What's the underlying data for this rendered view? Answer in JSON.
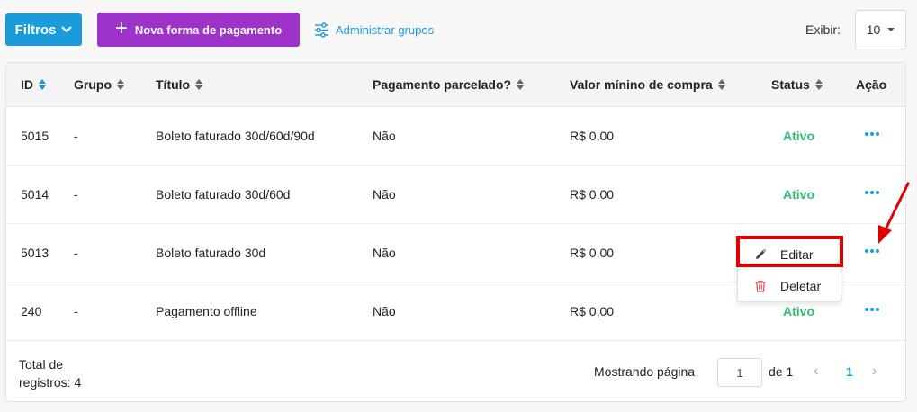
{
  "toolbar": {
    "filtros_label": "Filtros",
    "nova_label": "Nova forma de pagamento",
    "admin_label": "Administrar grupos",
    "exibir_label": "Exibir:",
    "exibir_value": "10"
  },
  "table": {
    "headers": {
      "id": "ID",
      "grupo": "Grupo",
      "titulo": "Título",
      "parcelado": "Pagamento parcelado?",
      "valor": "Valor mínino de compra",
      "status": "Status",
      "acao": "Ação"
    },
    "rows": [
      {
        "id": "5015",
        "grupo": "-",
        "titulo": "Boleto faturado 30d/60d/90d",
        "parcelado": "Não",
        "valor": "R$ 0,00",
        "status": "Ativo"
      },
      {
        "id": "5014",
        "grupo": "-",
        "titulo": "Boleto faturado 30d/60d",
        "parcelado": "Não",
        "valor": "R$ 0,00",
        "status": "Ativo"
      },
      {
        "id": "5013",
        "grupo": "-",
        "titulo": "Boleto faturado 30d",
        "parcelado": "Não",
        "valor": "R$ 0,00",
        "status": ""
      },
      {
        "id": "240",
        "grupo": "-",
        "titulo": "Pagamento offline",
        "parcelado": "Não",
        "valor": "R$ 0,00",
        "status": "Ativo"
      }
    ]
  },
  "footer": {
    "total_label": "Total de registros: 4",
    "mostrando_label": "Mostrando página",
    "page_placeholder": "1",
    "de_label": "de 1",
    "current_page": "1",
    "prev_icon": "‹",
    "next_icon": "›"
  },
  "menu": {
    "editar_label": "Editar",
    "deletar_label": "Deletar"
  },
  "colors": {
    "accent": "#1a9bdb",
    "purple": "#9d33c9",
    "active_status": "#2fbf71",
    "highlight": "#e00000"
  }
}
